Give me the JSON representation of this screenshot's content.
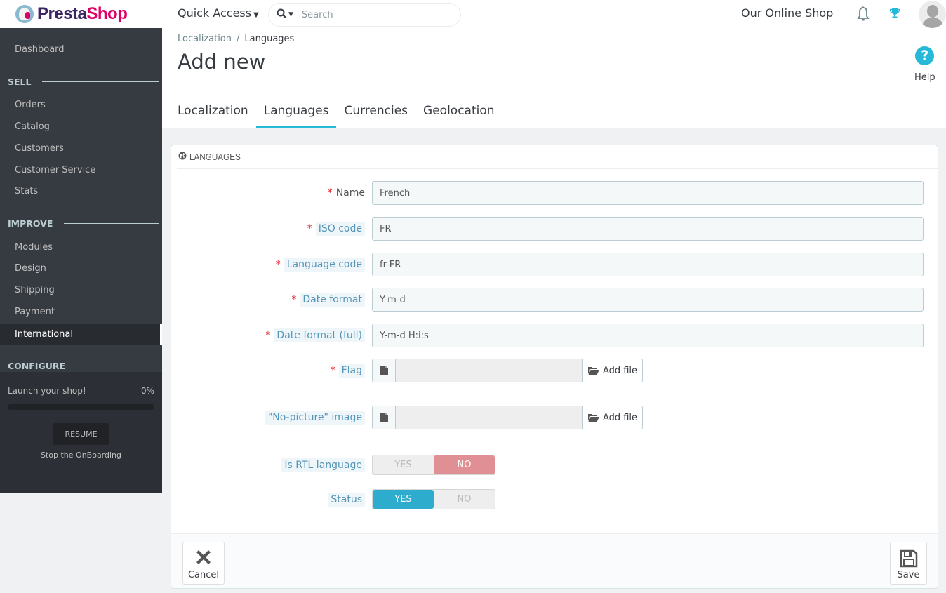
{
  "header": {
    "logo_part1": "Presta",
    "logo_part2": "Shop",
    "quick_access": "Quick Access",
    "search_placeholder": "Search",
    "shop_name": "Our Online Shop",
    "icons": [
      "bell-icon",
      "trophy-icon",
      "avatar"
    ]
  },
  "sidebar": {
    "dashboard": "Dashboard",
    "sections": [
      {
        "title": "SELL",
        "items": [
          "Orders",
          "Catalog",
          "Customers",
          "Customer Service",
          "Stats"
        ]
      },
      {
        "title": "IMPROVE",
        "items": [
          "Modules",
          "Design",
          "Shipping",
          "Payment",
          "International"
        ]
      },
      {
        "title": "CONFIGURE",
        "items": []
      }
    ],
    "active_item": "International",
    "onboarding": {
      "text": "Launch your shop!",
      "percent_label": "0%",
      "progress": 0,
      "resume": "RESUME",
      "stop": "Stop the OnBoarding"
    }
  },
  "page": {
    "breadcrumb": {
      "parent": "Localization",
      "separator": "/",
      "current": "Languages"
    },
    "title": "Add new",
    "help": "Help",
    "tabs": [
      {
        "label": "Localization",
        "active": false
      },
      {
        "label": "Languages",
        "active": true
      },
      {
        "label": "Currencies",
        "active": false
      },
      {
        "label": "Geolocation",
        "active": false
      }
    ]
  },
  "panel": {
    "title": "LANGUAGES",
    "fields": {
      "name": {
        "label": "Name",
        "required": true,
        "value": "French"
      },
      "iso": {
        "label": "ISO code",
        "required": true,
        "value": "FR"
      },
      "lang_code": {
        "label": "Language code",
        "required": true,
        "value": "fr-FR"
      },
      "date_format": {
        "label": "Date format",
        "required": true,
        "value": "Y-m-d"
      },
      "date_format_full": {
        "label": "Date format (full)",
        "required": true,
        "value": "Y-m-d H:i:s"
      },
      "flag": {
        "label": "Flag",
        "required": true,
        "button": "Add file"
      },
      "no_picture": {
        "label": "\"No-picture\" image",
        "required": false,
        "button": "Add file"
      },
      "rtl": {
        "label": "Is RTL language",
        "yes": "YES",
        "no": "NO",
        "value": "NO"
      },
      "status": {
        "label": "Status",
        "yes": "YES",
        "no": "NO",
        "value": "YES"
      }
    },
    "required_mark": "*",
    "cancel": "Cancel",
    "save": "Save"
  },
  "colors": {
    "accent": "#25b9d7",
    "sidebar_bg": "#363a41",
    "switch_no_active": "#e08f95",
    "switch_yes_active": "#2eacce",
    "brand_dark": "#3b2462",
    "brand_pink": "#df0067"
  }
}
